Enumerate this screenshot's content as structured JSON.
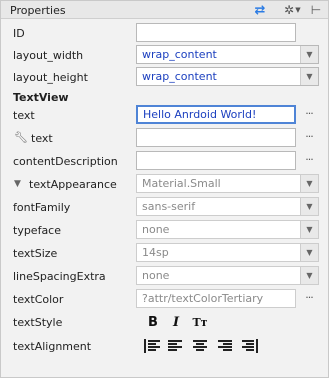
{
  "panel": {
    "title": "Properties",
    "swap_icon": "swap-arrows-icon",
    "gear_icon": "gear-icon",
    "pin_icon": "pin-icon"
  },
  "rows": {
    "id": {
      "label": "ID",
      "value": ""
    },
    "layout_width": {
      "label": "layout_width",
      "value": "wrap_content"
    },
    "layout_height": {
      "label": "layout_height",
      "value": "wrap_content"
    },
    "section": "TextView",
    "text": {
      "label": "text",
      "value": "Hello Anrdoid World!"
    },
    "tools_text": {
      "label": "text",
      "value": ""
    },
    "content_description": {
      "label": "contentDescription",
      "value": ""
    },
    "text_appearance": {
      "label": "textAppearance",
      "value": "Material.Small"
    },
    "font_family": {
      "label": "fontFamily",
      "value": "sans-serif"
    },
    "typeface": {
      "label": "typeface",
      "value": "none"
    },
    "text_size": {
      "label": "textSize",
      "value": "14sp"
    },
    "line_spacing_extra": {
      "label": "lineSpacingExtra",
      "value": "none"
    },
    "text_color": {
      "label": "textColor",
      "value": "?attr/textColorTertiary"
    },
    "text_style": {
      "label": "textStyle",
      "bold": "B",
      "italic": "I",
      "all_caps": "Tт"
    },
    "text_alignment": {
      "label": "textAlignment"
    }
  },
  "dots": "···",
  "colors": {
    "accent": "#2a7be4",
    "value_blue": "#1b3fbf",
    "focus_border": "#4f84d6",
    "disabled_text": "#8a8a8a"
  }
}
